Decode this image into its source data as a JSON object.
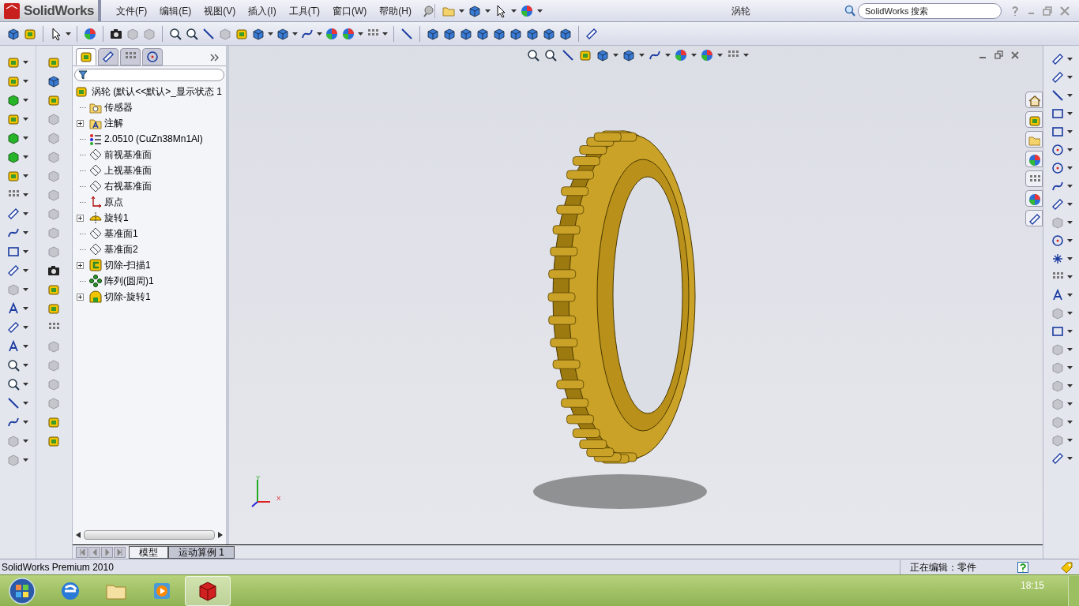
{
  "app": {
    "logo_text": "SolidWorks"
  },
  "menu": [
    {
      "label": "文件(F)"
    },
    {
      "label": "编辑(E)"
    },
    {
      "label": "视图(V)"
    },
    {
      "label": "插入(I)"
    },
    {
      "label": "工具(T)"
    },
    {
      "label": "窗口(W)"
    },
    {
      "label": "帮助(H)"
    }
  ],
  "window": {
    "title": "涡轮"
  },
  "search": {
    "placeholder": "SolidWorks 搜索"
  },
  "feature_tree": {
    "tabs": [
      {
        "kind": "features",
        "selected": true
      },
      {
        "kind": "properties",
        "selected": false
      },
      {
        "kind": "configurations",
        "selected": false
      },
      {
        "kind": "display",
        "selected": false
      }
    ],
    "root": {
      "label": "涡轮  (默认<<默认>_显示状态 1"
    },
    "items": [
      {
        "kind": "sensors",
        "label": "传感器",
        "expandable": false
      },
      {
        "kind": "annotations",
        "label": "注解",
        "expandable": true
      },
      {
        "kind": "material",
        "label": "2.0510 (CuZn38Mn1Al)",
        "expandable": false
      },
      {
        "kind": "plane",
        "label": "前视基准面",
        "expandable": false
      },
      {
        "kind": "plane",
        "label": "上视基准面",
        "expandable": false
      },
      {
        "kind": "plane",
        "label": "右视基准面",
        "expandable": false
      },
      {
        "kind": "origin",
        "label": "原点",
        "expandable": false
      },
      {
        "kind": "revolve",
        "label": "旋转1",
        "expandable": true
      },
      {
        "kind": "plane",
        "label": "基准面1",
        "expandable": false
      },
      {
        "kind": "plane",
        "label": "基准面2",
        "expandable": false
      },
      {
        "kind": "cut_sweep",
        "label": "切除-扫描1",
        "expandable": true
      },
      {
        "kind": "pattern",
        "label": "阵列(圆周)1",
        "expandable": false
      },
      {
        "kind": "cut_revolve",
        "label": "切除-旋转1",
        "expandable": true
      }
    ]
  },
  "triad": {
    "y_label": "Y",
    "x_label": "X"
  },
  "bottom_tabs": [
    {
      "label": "模型",
      "selected": true
    },
    {
      "label": "运动算例 1",
      "selected": false
    }
  ],
  "status_bar": {
    "product": "SolidWorks Premium 2010",
    "mode": "正在编辑：零件"
  },
  "taskbar": {
    "apps": [
      {
        "kind": "browser",
        "selected": false
      },
      {
        "kind": "folder",
        "selected": false
      },
      {
        "kind": "media",
        "selected": false
      },
      {
        "kind": "solidworks",
        "selected": true
      }
    ],
    "clock": "18:15"
  }
}
